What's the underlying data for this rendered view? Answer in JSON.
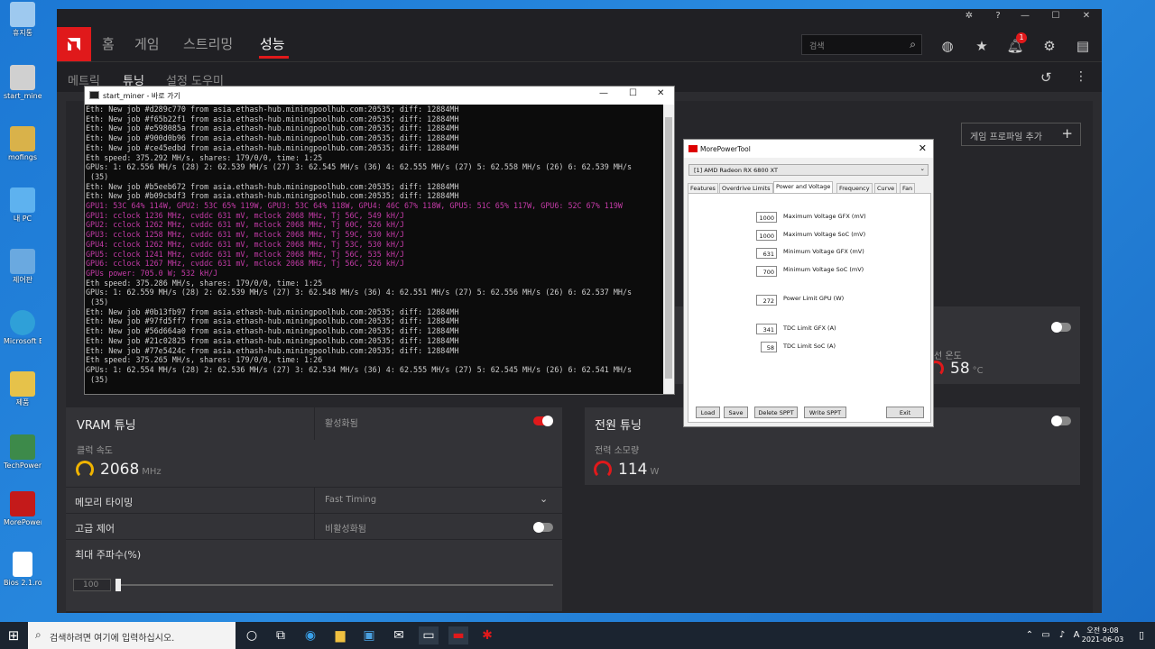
{
  "desktop": {
    "icons": [
      {
        "label": "휴지통",
        "color": "#9ec9ef"
      },
      {
        "label": "start_miner - 바로 가기",
        "color": "#d0d0d0"
      },
      {
        "label": "mofings",
        "color": "#d9b24a"
      },
      {
        "label": "내 PC",
        "color": "#5eb2ef"
      },
      {
        "label": "제어판",
        "color": "#6aa9e0"
      },
      {
        "label": "Microsoft Edge",
        "color": "#2fa0d8"
      },
      {
        "label": "제품",
        "color": "#e6c24a"
      },
      {
        "label": "TechPowerUp GPU-Z",
        "color": "#3d8a4a"
      },
      {
        "label": "MorePowerTool",
        "color": "#c41a1a"
      },
      {
        "label": "Bios 2.1.rom",
        "color": "#ffffff"
      }
    ]
  },
  "amd": {
    "nav": [
      "홈",
      "게임",
      "스트리밍",
      "성능"
    ],
    "search_placeholder": "검색",
    "notification_count": "1",
    "subtabs": [
      "메트릭",
      "튜닝",
      "설정 도우미"
    ],
    "add_game_profile": "게임 프로파일 추가",
    "vram": {
      "title": "VRAM 튜닝",
      "state_label": "활성화됨",
      "clock_label": "클럭 속도",
      "clock_value": "2068",
      "clock_unit": "MHz",
      "memory_timing_label": "메모리 타이밍",
      "memory_timing_value": "Fast Timing",
      "advanced_label": "고급 제어",
      "advanced_state": "비활성화됨",
      "max_freq_label": "최대 주파수(%)",
      "max_freq_value": "100"
    },
    "power": {
      "title": "전원 튜닝",
      "consumption_label": "전력 소모량",
      "consumption_value": "114",
      "consumption_unit": "W"
    },
    "temp": {
      "label_partial": "선 온도",
      "value": "58",
      "unit": "°C"
    }
  },
  "console": {
    "title": "start_miner - 바로 가기",
    "lines": [
      {
        "t": "Eth: New job #d289c770 from asia.ethash-hub.miningpoolhub.com:20535; diff: 12884MH",
        "c": "w"
      },
      {
        "t": "Eth: New job #f65b22f1 from asia.ethash-hub.miningpoolhub.com:20535; diff: 12884MH",
        "c": "w"
      },
      {
        "t": "Eth: New job #e598085a from asia.ethash-hub.miningpoolhub.com:20535; diff: 12884MH",
        "c": "w"
      },
      {
        "t": "Eth: New job #900d0b96 from asia.ethash-hub.miningpoolhub.com:20535; diff: 12884MH",
        "c": "w"
      },
      {
        "t": "Eth: New job #ce45edbd from asia.ethash-hub.miningpoolhub.com:20535; diff: 12884MH",
        "c": "w"
      },
      {
        "t": "Eth speed: 375.292 MH/s, shares: 179/0/0, time: 1:25",
        "c": "w"
      },
      {
        "t": "GPUs: 1: 62.556 MH/s (28) 2: 62.539 MH/s (27) 3: 62.545 MH/s (36) 4: 62.555 MH/s (27) 5: 62.558 MH/s (26) 6: 62.539 MH/s",
        "c": "w"
      },
      {
        "t": " (35)",
        "c": "w"
      },
      {
        "t": "Eth: New job #b5eeb672 from asia.ethash-hub.miningpoolhub.com:20535; diff: 12884MH",
        "c": "w"
      },
      {
        "t": "Eth: New job #b09cbdf3 from asia.ethash-hub.miningpoolhub.com:20535; diff: 12884MH",
        "c": "w"
      },
      {
        "t": "GPU1: 53C 64% 114W, GPU2: 53C 65% 119W, GPU3: 53C 64% 118W, GPU4: 46C 67% 118W, GPU5: 51C 65% 117W, GPU6: 52C 67% 119W",
        "c": "m"
      },
      {
        "t": "GPU1: cclock 1236 MHz, cvddc 631 mV, mclock 2068 MHz, Tj 56C, 549 kH/J",
        "c": "m"
      },
      {
        "t": "GPU2: cclock 1262 MHz, cvddc 631 mV, mclock 2068 MHz, Tj 60C, 526 kH/J",
        "c": "m"
      },
      {
        "t": "GPU3: cclock 1258 MHz, cvddc 631 mV, mclock 2068 MHz, Tj 59C, 530 kH/J",
        "c": "m"
      },
      {
        "t": "GPU4: cclock 1262 MHz, cvddc 631 mV, mclock 2068 MHz, Tj 53C, 530 kH/J",
        "c": "m"
      },
      {
        "t": "GPU5: cclock 1241 MHz, cvddc 631 mV, mclock 2068 MHz, Tj 56C, 535 kH/J",
        "c": "m"
      },
      {
        "t": "GPU6: cclock 1267 MHz, cvddc 631 mV, mclock 2068 MHz, Tj 56C, 526 kH/J",
        "c": "m"
      },
      {
        "t": "GPUs power: 705.0 W; 532 kH/J",
        "c": "m"
      },
      {
        "t": "Eth speed: 375.286 MH/s, shares: 179/0/0, time: 1:25",
        "c": "w"
      },
      {
        "t": "GPUs: 1: 62.559 MH/s (28) 2: 62.539 MH/s (27) 3: 62.548 MH/s (36) 4: 62.551 MH/s (27) 5: 62.556 MH/s (26) 6: 62.537 MH/s",
        "c": "w"
      },
      {
        "t": " (35)",
        "c": "w"
      },
      {
        "t": "Eth: New job #0b13fb97 from asia.ethash-hub.miningpoolhub.com:20535; diff: 12884MH",
        "c": "w"
      },
      {
        "t": "Eth: New job #97fd5ff7 from asia.ethash-hub.miningpoolhub.com:20535; diff: 12884MH",
        "c": "w"
      },
      {
        "t": "Eth: New job #56d664a0 from asia.ethash-hub.miningpoolhub.com:20535; diff: 12884MH",
        "c": "w"
      },
      {
        "t": "Eth: New job #21c02825 from asia.ethash-hub.miningpoolhub.com:20535; diff: 12884MH",
        "c": "w"
      },
      {
        "t": "Eth: New job #77e5424c from asia.ethash-hub.miningpoolhub.com:20535; diff: 12884MH",
        "c": "w"
      },
      {
        "t": "Eth speed: 375.265 MH/s, shares: 179/0/0, time: 1:26",
        "c": "w"
      },
      {
        "t": "GPUs: 1: 62.554 MH/s (28) 2: 62.536 MH/s (27) 3: 62.534 MH/s (36) 4: 62.555 MH/s (27) 5: 62.545 MH/s (26) 6: 62.541 MH/s",
        "c": "w"
      },
      {
        "t": " (35)",
        "c": "w"
      }
    ]
  },
  "mpt": {
    "title": "MorePowerTool",
    "gpu_select": "[1] AMD Radeon RX 6800 XT",
    "tabs": [
      "Features",
      "Overdrive Limits",
      "Power and Voltage",
      "Frequency",
      "Curve",
      "Fan"
    ],
    "active_tab": "Power and Voltage",
    "fields": [
      {
        "value": "1000",
        "label": "Maximum Voltage GFX (mV)"
      },
      {
        "value": "1000",
        "label": "Maximum Voltage SoC (mV)"
      },
      {
        "value": "631",
        "label": "Minimum Voltage GFX (mV)"
      },
      {
        "value": "700",
        "label": "Minimum Voltage SoC (mV)"
      },
      {
        "value": "272",
        "label": "Power Limit GPU (W)"
      },
      {
        "value": "341",
        "label": "TDC Limit GFX (A)"
      },
      {
        "value": "58",
        "label": "TDC Limit SoC (A)"
      }
    ],
    "buttons": [
      "Load",
      "Save",
      "Delete SPPT",
      "Write SPPT",
      "Exit"
    ]
  },
  "taskbar": {
    "search_placeholder": "검색하려면 여기에 입력하십시오.",
    "time": "오전 9:08",
    "date": "2021-06-03"
  }
}
